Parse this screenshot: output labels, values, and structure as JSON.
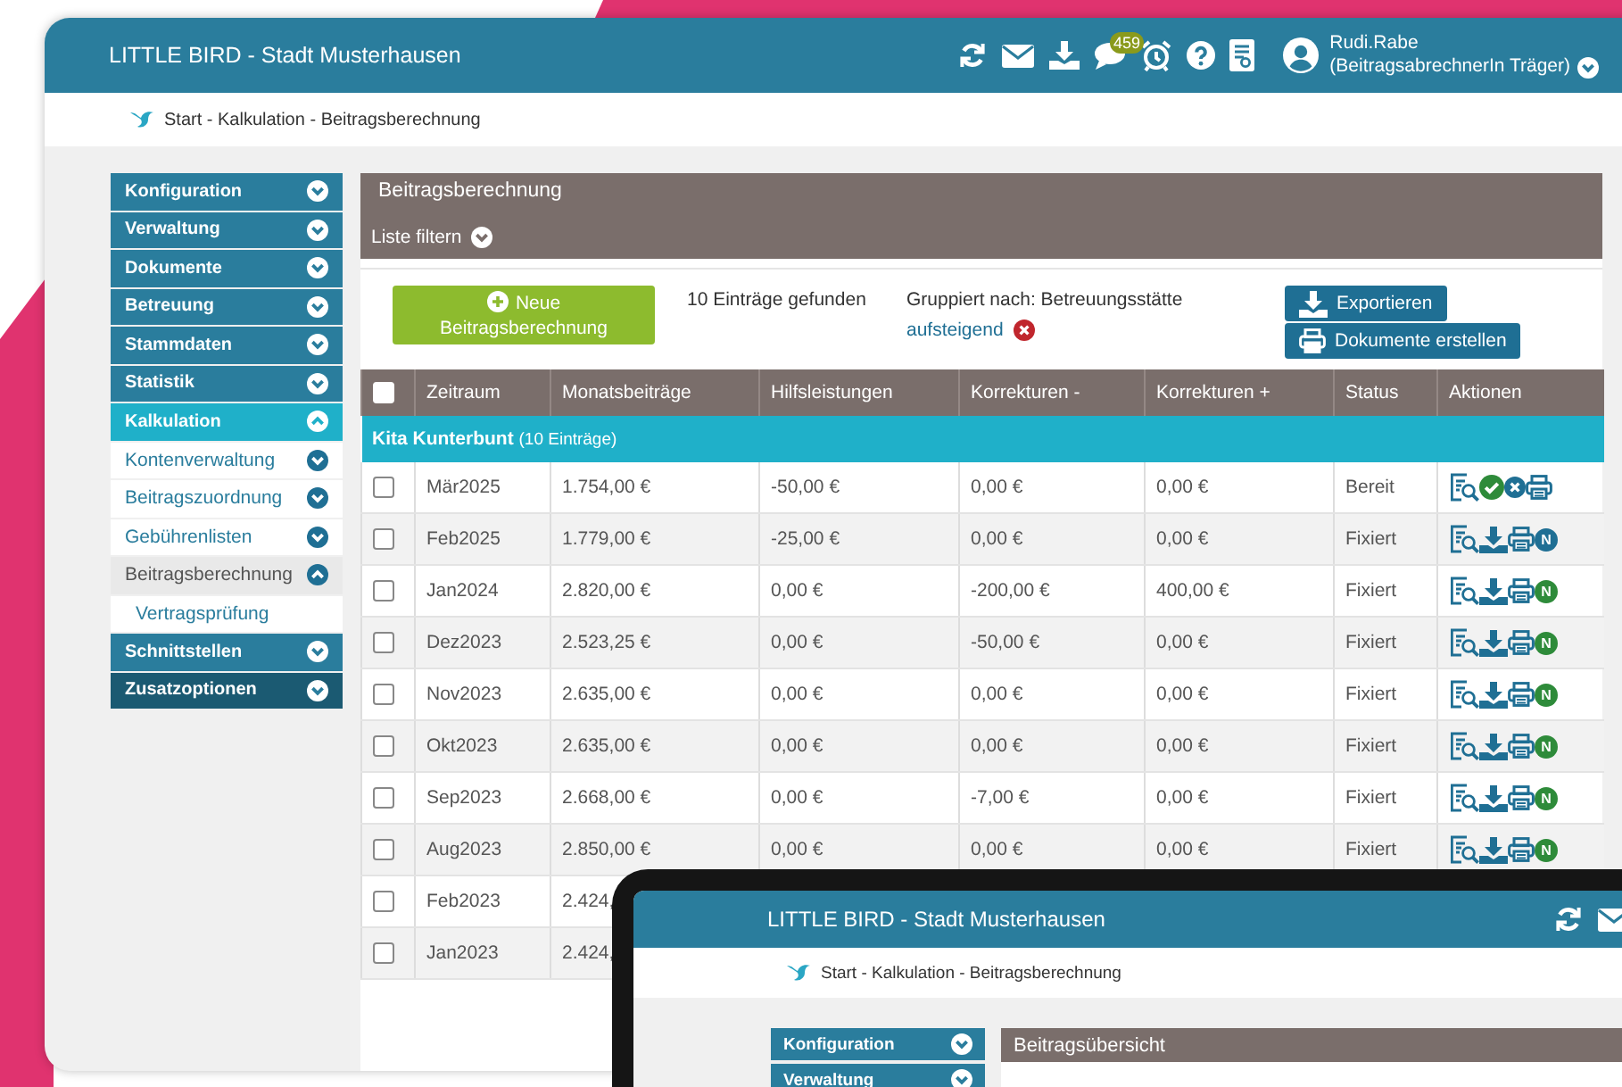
{
  "header": {
    "title": "LITTLE BIRD - Stadt Musterhausen",
    "notification_count": "459",
    "user_name": "Rudi.Rabe",
    "user_role": "(BeitragsabrechnerIn Träger)"
  },
  "breadcrumb": "Start - Kalkulation - Beitragsberechnung",
  "sidebar": {
    "items": [
      {
        "label": "Konfiguration",
        "expanded": false,
        "selected": false,
        "hovered": false
      },
      {
        "label": "Verwaltung",
        "expanded": false,
        "selected": false,
        "hovered": false
      },
      {
        "label": "Dokumente",
        "expanded": false,
        "selected": false,
        "hovered": false
      },
      {
        "label": "Betreuung",
        "expanded": false,
        "selected": false,
        "hovered": false
      },
      {
        "label": "Stammdaten",
        "expanded": false,
        "selected": false,
        "hovered": false
      },
      {
        "label": "Statistik",
        "expanded": false,
        "selected": false,
        "hovered": false
      },
      {
        "label": "Kalkulation",
        "expanded": true,
        "selected": true,
        "hovered": false,
        "children": [
          {
            "label": "Kontenverwaltung",
            "expanded": false,
            "selected": false
          },
          {
            "label": "Beitragszuordnung",
            "expanded": false,
            "selected": false
          },
          {
            "label": "Gebührenlisten",
            "expanded": false,
            "selected": false
          },
          {
            "label": "Beitragsberechnung",
            "expanded": true,
            "selected": true,
            "children": [
              {
                "label": "Vertragsprüfung",
                "selected": false
              }
            ]
          }
        ]
      },
      {
        "label": "Schnittstellen",
        "expanded": false,
        "selected": false,
        "hovered": false
      },
      {
        "label": "Zusatzoptionen",
        "expanded": false,
        "selected": false,
        "hovered": true
      }
    ]
  },
  "panel": {
    "title": "Beitragsberechnung",
    "filter_label": "Liste filtern",
    "new_button": "Neue Beitragsberechnung",
    "result_count": "10 Einträge gefunden",
    "grouping_label": "Gruppiert nach: Betreuungsstätte",
    "sort_link": "aufsteigend",
    "export_button": "Exportieren",
    "documents_button": "Dokumente erstellen"
  },
  "table": {
    "select_all_checked": false,
    "columns": [
      "Zeitraum",
      "Monatsbeiträge",
      "Hilfsleistungen",
      "Korrekturen -",
      "Korrekturen +",
      "Status",
      "Aktionen"
    ],
    "group": {
      "name": "Kita Kunterbunt",
      "count": "(10 Einträge)"
    },
    "rows": [
      {
        "checked": false,
        "cells": [
          "Mär2025",
          "1.754,00 €",
          "-50,00 €",
          "0,00 €",
          "0,00 €",
          "Bereit"
        ],
        "actions": [
          {
            "kind": "view"
          },
          {
            "kind": "approve"
          },
          {
            "kind": "reject"
          },
          {
            "kind": "print"
          }
        ]
      },
      {
        "checked": false,
        "cells": [
          "Feb2025",
          "1.779,00 €",
          "-25,00 €",
          "0,00 €",
          "0,00 €",
          "Fixiert"
        ],
        "actions": [
          {
            "kind": "view"
          },
          {
            "kind": "download"
          },
          {
            "kind": "print"
          },
          {
            "kind": "badge",
            "text": "N",
            "color": "#1f6f94"
          }
        ]
      },
      {
        "checked": false,
        "cells": [
          "Jan2024",
          "2.820,00 €",
          "0,00 €",
          "-200,00 €",
          "400,00 €",
          "Fixiert"
        ],
        "actions": [
          {
            "kind": "view"
          },
          {
            "kind": "download"
          },
          {
            "kind": "print"
          },
          {
            "kind": "badge",
            "text": "N",
            "color": "#2e8b3a"
          }
        ]
      },
      {
        "checked": false,
        "cells": [
          "Dez2023",
          "2.523,25 €",
          "0,00 €",
          "-50,00 €",
          "0,00 €",
          "Fixiert"
        ],
        "actions": [
          {
            "kind": "view"
          },
          {
            "kind": "download"
          },
          {
            "kind": "print"
          },
          {
            "kind": "badge",
            "text": "N",
            "color": "#2e8b3a"
          }
        ]
      },
      {
        "checked": false,
        "cells": [
          "Nov2023",
          "2.635,00 €",
          "0,00 €",
          "0,00 €",
          "0,00 €",
          "Fixiert"
        ],
        "actions": [
          {
            "kind": "view"
          },
          {
            "kind": "download"
          },
          {
            "kind": "print"
          },
          {
            "kind": "badge",
            "text": "N",
            "color": "#2e8b3a"
          }
        ]
      },
      {
        "checked": false,
        "cells": [
          "Okt2023",
          "2.635,00 €",
          "0,00 €",
          "0,00 €",
          "0,00 €",
          "Fixiert"
        ],
        "actions": [
          {
            "kind": "view"
          },
          {
            "kind": "download"
          },
          {
            "kind": "print"
          },
          {
            "kind": "badge",
            "text": "N",
            "color": "#2e8b3a"
          }
        ]
      },
      {
        "checked": false,
        "cells": [
          "Sep2023",
          "2.668,00 €",
          "0,00 €",
          "-7,00 €",
          "0,00 €",
          "Fixiert"
        ],
        "actions": [
          {
            "kind": "view"
          },
          {
            "kind": "download"
          },
          {
            "kind": "print"
          },
          {
            "kind": "badge",
            "text": "N",
            "color": "#2e8b3a"
          }
        ]
      },
      {
        "checked": false,
        "cells": [
          "Aug2023",
          "2.850,00 €",
          "0,00 €",
          "0,00 €",
          "0,00 €",
          "Fixiert"
        ],
        "actions": [
          {
            "kind": "view"
          },
          {
            "kind": "download"
          },
          {
            "kind": "print"
          },
          {
            "kind": "badge",
            "text": "N",
            "color": "#2e8b3a"
          }
        ]
      },
      {
        "checked": false,
        "cells": [
          "Feb2023",
          "2.424,"
        ]
      },
      {
        "checked": false,
        "cells": [
          "Jan2023",
          "2.424,"
        ]
      }
    ]
  },
  "tablet": {
    "title": "LITTLE BIRD - Stadt Musterhausen",
    "breadcrumb": "Start - Kalkulation - Beitragsberechnung",
    "sidebar_items": [
      {
        "label": "Konfiguration",
        "expanded": false
      },
      {
        "label": "Verwaltung",
        "expanded": false
      }
    ],
    "panel_title": "Beitragsübersicht"
  }
}
